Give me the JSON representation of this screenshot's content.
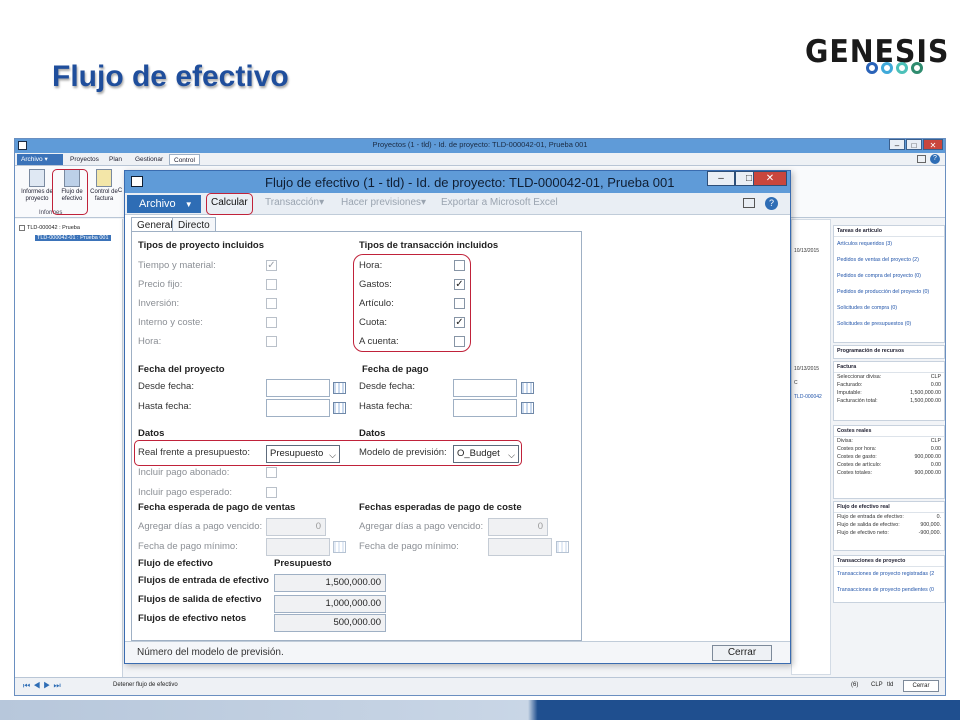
{
  "slide": {
    "title": "Flujo de efectivo",
    "logo_text": "GENESIS",
    "logo_ring_colors": [
      "#2a63b8",
      "#3fa9d9",
      "#4cc1b9",
      "#2f8c6f"
    ]
  },
  "outer_window": {
    "title": "Proyectos (1 - tld) - Id. de proyecto: TLD-000042-01, Prueba 001",
    "ribbon_tabs": [
      "Archivo ▾",
      "Proyectos",
      "Plan",
      "Gestionar",
      "Control"
    ],
    "ribbon_buttons": [
      "Informes de proyecto",
      "Flujo de efectivo",
      "Control de factura",
      "C"
    ],
    "ribbon_group_label": "Informes",
    "tree": [
      "TLD-000042 : Prueba",
      "TLD-000042-01 : Prueba 001"
    ],
    "status_text": "Detener flujo de efectivo",
    "status_right": [
      "(6)",
      "CLP",
      "tld"
    ],
    "status_cerrar": "Cerrar",
    "mid_column": {
      "dates_top": "10/13/2015",
      "dates_mid": "10/13/2015",
      "c_label": "C",
      "project_link": "TLD-000042"
    },
    "right_pane": {
      "tareas_title": "Tareas de artículo",
      "tareas_links": [
        "Artículos requeridos (3)",
        "Pedidos de ventas del proyecto (2)",
        "Pedidos de compra del proyecto (0)",
        "Pedidos de producción del proyecto (0)",
        "Solicitudes de compra (0)",
        "Solicitudes de presupuestos (0)"
      ],
      "programacion_title": "Programación de recursos",
      "factura_title": "Factura",
      "factura_rows": [
        {
          "label": "Seleccionar divisa:",
          "value": "CLP"
        },
        {
          "label": "Facturado:",
          "value": "0.00"
        },
        {
          "label": "Imputable:",
          "value": "1,500,000.00"
        },
        {
          "label": "Facturación total:",
          "value": "1,500,000.00"
        }
      ],
      "costes_title": "Costes reales",
      "costes_rows": [
        {
          "label": "Divisa:",
          "value": "CLP"
        },
        {
          "label": "Costes por hora:",
          "value": "0.00"
        },
        {
          "label": "Costes de gasto:",
          "value": "900,000.00"
        },
        {
          "label": "Costes de artículo:",
          "value": "0.00"
        },
        {
          "label": "Costes totales:",
          "value": "900,000.00"
        }
      ],
      "flujo_title": "Flujo de efectivo real",
      "flujo_rows": [
        {
          "label": "Flujo de entrada de efectivo:",
          "value": "0."
        },
        {
          "label": "Flujo de salida de efectivo:",
          "value": "900,000."
        },
        {
          "label": "Flujo de efectivo neto:",
          "value": "-900,000."
        }
      ],
      "transacciones_title": "Transacciones de proyecto",
      "transacciones_links": [
        "Transacciones de proyecto registradas (2",
        "Transacciones de proyecto pendientes (0"
      ]
    }
  },
  "dialog": {
    "title": "Flujo de efectivo (1 - tld) - Id. de proyecto: TLD-000042-01, Prueba 001",
    "toolbar": {
      "archivo": "Archivo",
      "calcular": "Calcular",
      "transaccion": "Transacción",
      "hacer_previsiones": "Hacer previsiones",
      "exportar": "Exportar a Microsoft Excel"
    },
    "tabs": [
      "General",
      "Directo"
    ],
    "tipos_proyecto": {
      "header": "Tipos de proyecto incluidos",
      "items": [
        {
          "label": "Tiempo y material:",
          "checked": true
        },
        {
          "label": "Precio fijo:",
          "checked": false
        },
        {
          "label": "Inversión:",
          "checked": false
        },
        {
          "label": "Interno y coste:",
          "checked": false
        },
        {
          "label": "Hora:",
          "checked": false
        }
      ]
    },
    "tipos_transaccion": {
      "header": "Tipos de transacción incluidos",
      "items": [
        {
          "label": "Hora:",
          "checked": false
        },
        {
          "label": "Gastos:",
          "checked": true
        },
        {
          "label": "Artículo:",
          "checked": false
        },
        {
          "label": "Cuota:",
          "checked": true
        },
        {
          "label": "A cuenta:",
          "checked": false
        }
      ]
    },
    "fecha_proyecto": {
      "header": "Fecha del proyecto",
      "desde": "Desde fecha:",
      "hasta": "Hasta fecha:"
    },
    "fecha_pago": {
      "header": "Fecha de pago",
      "desde": "Desde fecha:",
      "hasta": "Hasta fecha:"
    },
    "datos_left": {
      "header": "Datos",
      "real_label": "Real frente a presupuesto:",
      "real_value": "Presupuesto",
      "abonado_label": "Incluir pago abonado:",
      "esperado_label": "Incluir pago esperado:"
    },
    "datos_right": {
      "header": "Datos",
      "modelo_label": "Modelo de previsión:",
      "modelo_value": "O_Budget"
    },
    "pago_ventas": {
      "header": "Fecha esperada de pago de ventas",
      "dias_label": "Agregar días a pago vencido:",
      "dias_value": "0",
      "minimo_label": "Fecha de pago mínimo:"
    },
    "pago_coste": {
      "header": "Fechas esperadas de pago de coste",
      "dias_label": "Agregar días a pago vencido:",
      "dias_value": "0",
      "minimo_label": "Fecha de pago mínimo:"
    },
    "flujo": {
      "header": "Flujo de efectivo",
      "col_header": "Presupuesto",
      "rows": [
        {
          "label": "Flujos de entrada de efectivo",
          "value": "1,500,000.00"
        },
        {
          "label": "Flujos de salida de efectivo",
          "value": "1,000,000.00"
        },
        {
          "label": "Flujos de efectivo netos",
          "value": "500,000.00"
        }
      ]
    },
    "status_text": "Número del modelo de previsión.",
    "cerrar": "Cerrar"
  }
}
